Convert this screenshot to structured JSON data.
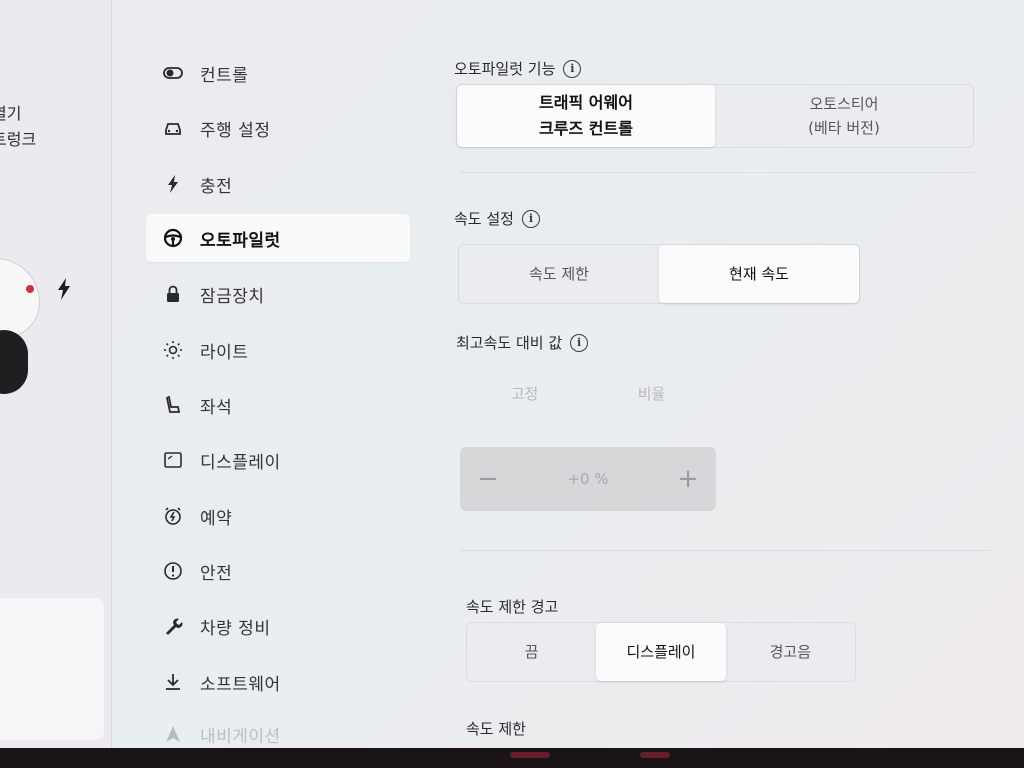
{
  "car_panel": {
    "line1": "열기",
    "line2": "트렁크"
  },
  "sidebar": {
    "items": [
      {
        "label": "컨트롤",
        "icon": "toggle-icon"
      },
      {
        "label": "주행 설정",
        "icon": "car-icon"
      },
      {
        "label": "충전",
        "icon": "bolt-icon"
      },
      {
        "label": "오토파일럿",
        "icon": "steering-wheel-icon"
      },
      {
        "label": "잠금장치",
        "icon": "lock-icon"
      },
      {
        "label": "라이트",
        "icon": "sun-icon"
      },
      {
        "label": "좌석",
        "icon": "seat-icon"
      },
      {
        "label": "디스플레이",
        "icon": "display-icon"
      },
      {
        "label": "예약",
        "icon": "alarm-icon"
      },
      {
        "label": "안전",
        "icon": "alert-icon"
      },
      {
        "label": "차량 정비",
        "icon": "wrench-icon"
      },
      {
        "label": "소프트웨어",
        "icon": "download-icon"
      },
      {
        "label": "내비게이션",
        "icon": "navigation-icon"
      }
    ],
    "active_index": 3
  },
  "autopilot_features": {
    "title": "오토파일럿 기능",
    "options": [
      {
        "line1": "트래픽 어웨어",
        "line2": "크루즈 컨트롤",
        "selected": true
      },
      {
        "line1": "오토스티어",
        "line2": "(베타 버전)",
        "selected": false
      }
    ]
  },
  "speed_setting": {
    "title": "속도 설정",
    "options": [
      {
        "label": "속도 제한",
        "selected": false
      },
      {
        "label": "현재 속도",
        "selected": true
      }
    ]
  },
  "offset": {
    "title": "최고속도 대비 값",
    "options": [
      {
        "label": "고정"
      },
      {
        "label": "비율"
      }
    ],
    "value": "+0 %",
    "minus": "−",
    "plus": "+"
  },
  "speed_limit_warning": {
    "title": "속도 제한 경고",
    "options": [
      {
        "label": "끔",
        "selected": false
      },
      {
        "label": "디스플레이",
        "selected": true
      },
      {
        "label": "경고음",
        "selected": false
      }
    ]
  },
  "speed_limit": {
    "title": "속도 제한"
  },
  "colors": {
    "accent_red": "#d03040",
    "selected_bg": "#fbfbfc"
  }
}
